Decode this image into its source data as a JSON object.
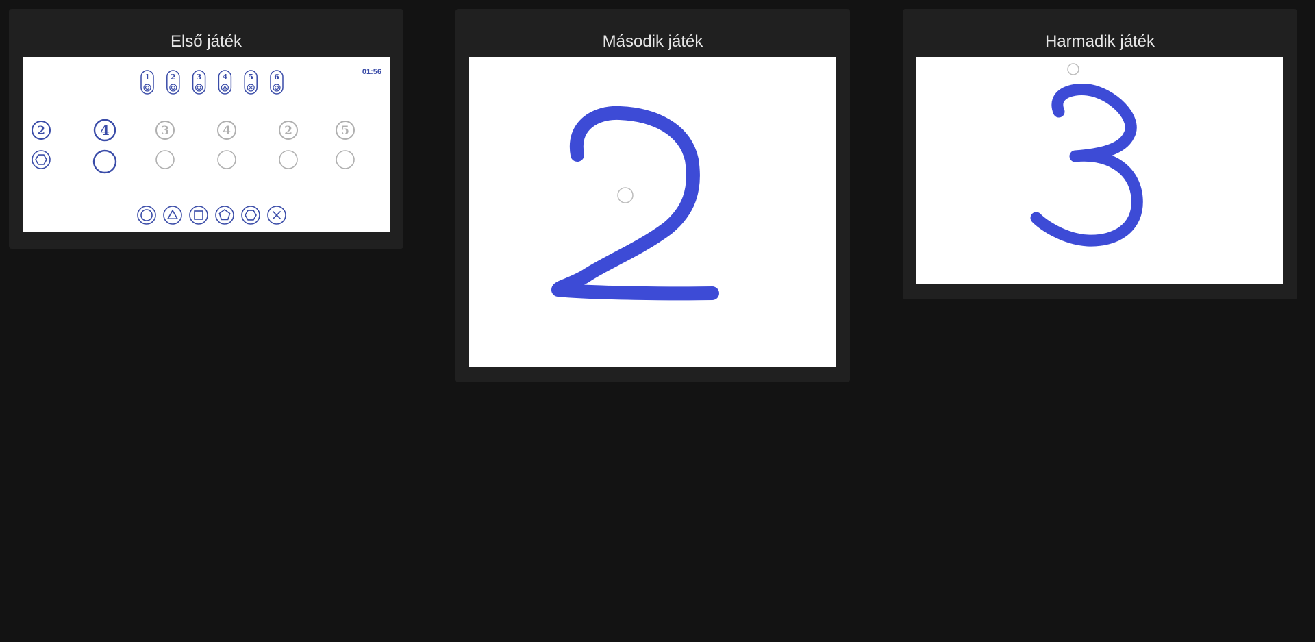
{
  "games": [
    {
      "title": "Első játék"
    },
    {
      "title": "Második játék"
    },
    {
      "title": "Harmadik játék"
    }
  ],
  "game1": {
    "timer": "01:56",
    "legend": [
      {
        "number": "1",
        "shape": "circle"
      },
      {
        "number": "2",
        "shape": "circle"
      },
      {
        "number": "3",
        "shape": "circle"
      },
      {
        "number": "4",
        "shape": "triangle"
      },
      {
        "number": "5",
        "shape": "x"
      },
      {
        "number": "6",
        "shape": "circle"
      }
    ],
    "sequence": [
      {
        "number": "2",
        "answer_shape": "hexagon",
        "state": "answered"
      },
      {
        "number": "4",
        "answer_shape": "none",
        "state": "current"
      },
      {
        "number": "3",
        "answer_shape": "none",
        "state": "pending"
      },
      {
        "number": "4",
        "answer_shape": "none",
        "state": "pending"
      },
      {
        "number": "2",
        "answer_shape": "none",
        "state": "pending"
      },
      {
        "number": "5",
        "answer_shape": "none",
        "state": "pending"
      }
    ],
    "shape_buttons": [
      {
        "shape": "circle",
        "name": "circle-shape-button"
      },
      {
        "shape": "triangle",
        "name": "triangle-shape-button"
      },
      {
        "shape": "square",
        "name": "square-shape-button"
      },
      {
        "shape": "pentagon",
        "name": "pentagon-shape-button"
      },
      {
        "shape": "hexagon",
        "name": "hexagon-shape-button"
      },
      {
        "shape": "x",
        "name": "x-shape-button"
      }
    ]
  },
  "game2": {
    "drawn_digit": "2"
  },
  "game3": {
    "drawn_digit": "3"
  },
  "colors": {
    "background": "#131313",
    "panel": "#202020",
    "title_text": "#e6e6e6",
    "accent_blue": "#3d4bd6",
    "game_blue": "#3a4ca8",
    "inactive_gray": "#b0b0b0"
  }
}
